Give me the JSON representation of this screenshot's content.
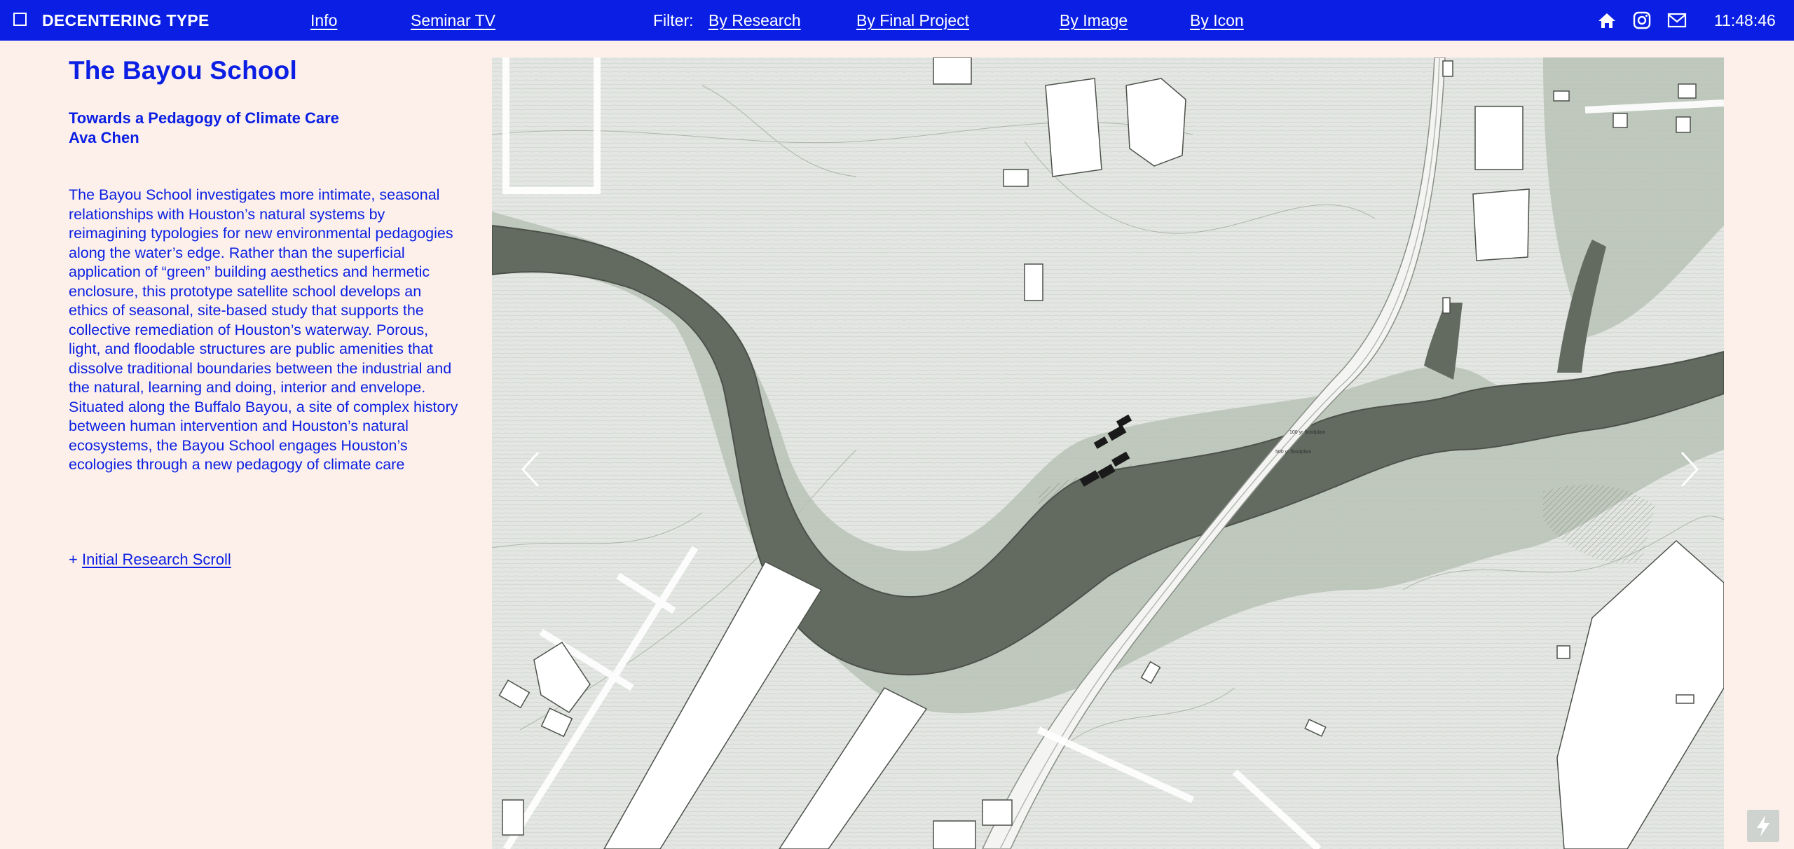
{
  "nav": {
    "brand": "DECENTERING TYPE",
    "info": "Info",
    "seminar": "Seminar TV",
    "filter_label": "Filter:",
    "filters": [
      "By Research",
      "By Final Project",
      "By Image",
      "By Icon"
    ],
    "clock": "11:48:46",
    "icons": [
      "home-icon",
      "instagram-icon",
      "mail-icon"
    ]
  },
  "project": {
    "title": "The Bayou School",
    "subtitle": "Towards a Pedagogy of Climate Care",
    "author": "Ava Chen",
    "description": "The Bayou School investigates more intimate, seasonal relationships with Houston’s natural systems by reimagining typologies for new environmental pedagogies along the water’s edge. Rather than the superficial application of “green” building aesthetics and hermetic enclosure, this prototype satellite school develops an ethics of seasonal, site-based study that supports the collective remediation of Houston’s waterway. Porous, light, and floodable structures are public amenities that dissolve traditional boundaries between the industrial and the natural, learning and doing, interior and envelope. Situated along the Buffalo Bayou, a site of complex history between human intervention and Houston’s natural ecosystems, the Bayou School engages Houston’s ecologies through a new pedagogy of climate care",
    "scroll_prefix": "+ ",
    "scroll_link": "Initial Research Scroll"
  },
  "map": {
    "labels": [
      "100 yr floodplain",
      "500 yr floodplain"
    ]
  },
  "colors": {
    "accent": "#0a1fe3",
    "background": "#fdf0ea",
    "water": "#636a60",
    "floodplain": "#b8c2b5",
    "land": "#e3e6e2"
  }
}
